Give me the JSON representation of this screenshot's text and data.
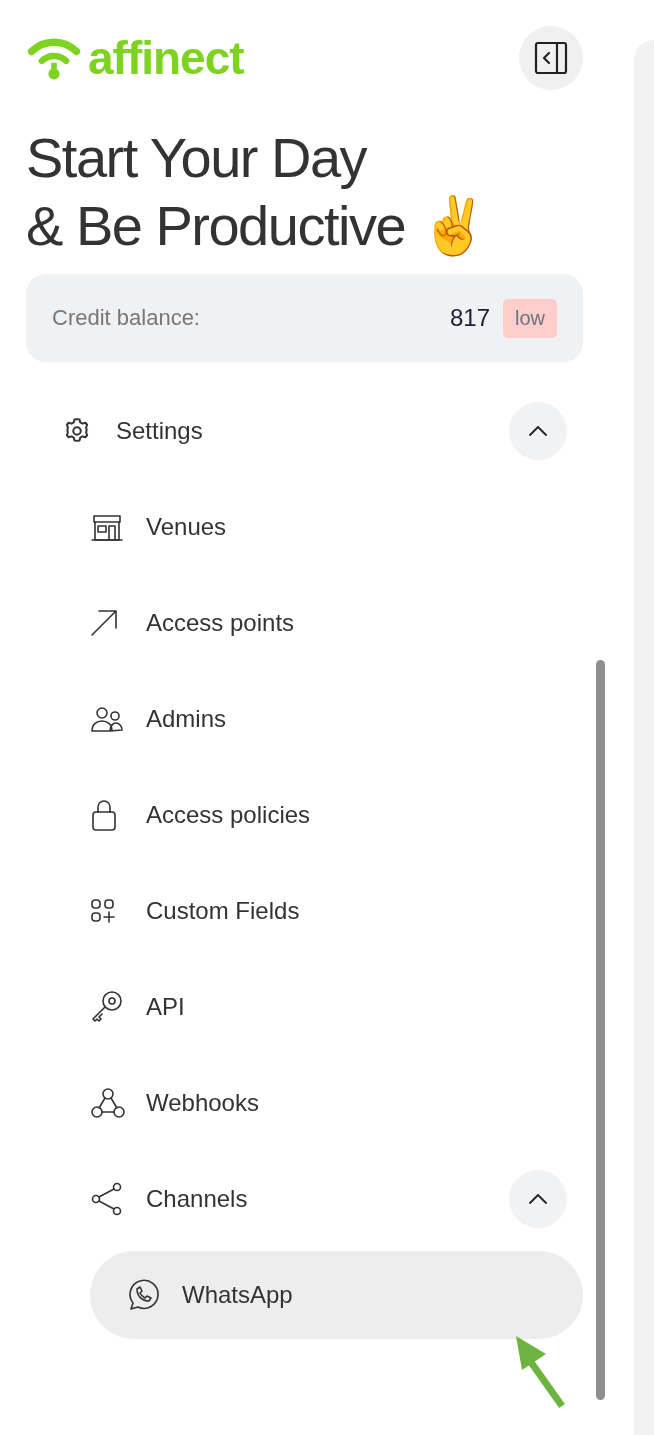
{
  "logo": {
    "text": "affinect"
  },
  "headline": [
    "Start Your Day",
    "& Be Productive ✌️"
  ],
  "credit": {
    "label": "Credit balance:",
    "value": "817",
    "badge": "low"
  },
  "nav": [
    {
      "label": "Settings",
      "expanded": true,
      "selected": false,
      "children": [
        {
          "label": "Venues",
          "selected": false
        },
        {
          "label": "Access points",
          "selected": false
        },
        {
          "label": "Admins",
          "selected": false
        },
        {
          "label": "Access policies",
          "selected": false
        },
        {
          "label": "Custom Fields",
          "selected": false
        },
        {
          "label": "API",
          "selected": false
        },
        {
          "label": "Webhooks",
          "selected": false
        },
        {
          "label": "Channels",
          "expanded": true,
          "selected": false,
          "children": [
            {
              "label": "WhatsApp",
              "selected": true
            }
          ]
        }
      ]
    }
  ]
}
